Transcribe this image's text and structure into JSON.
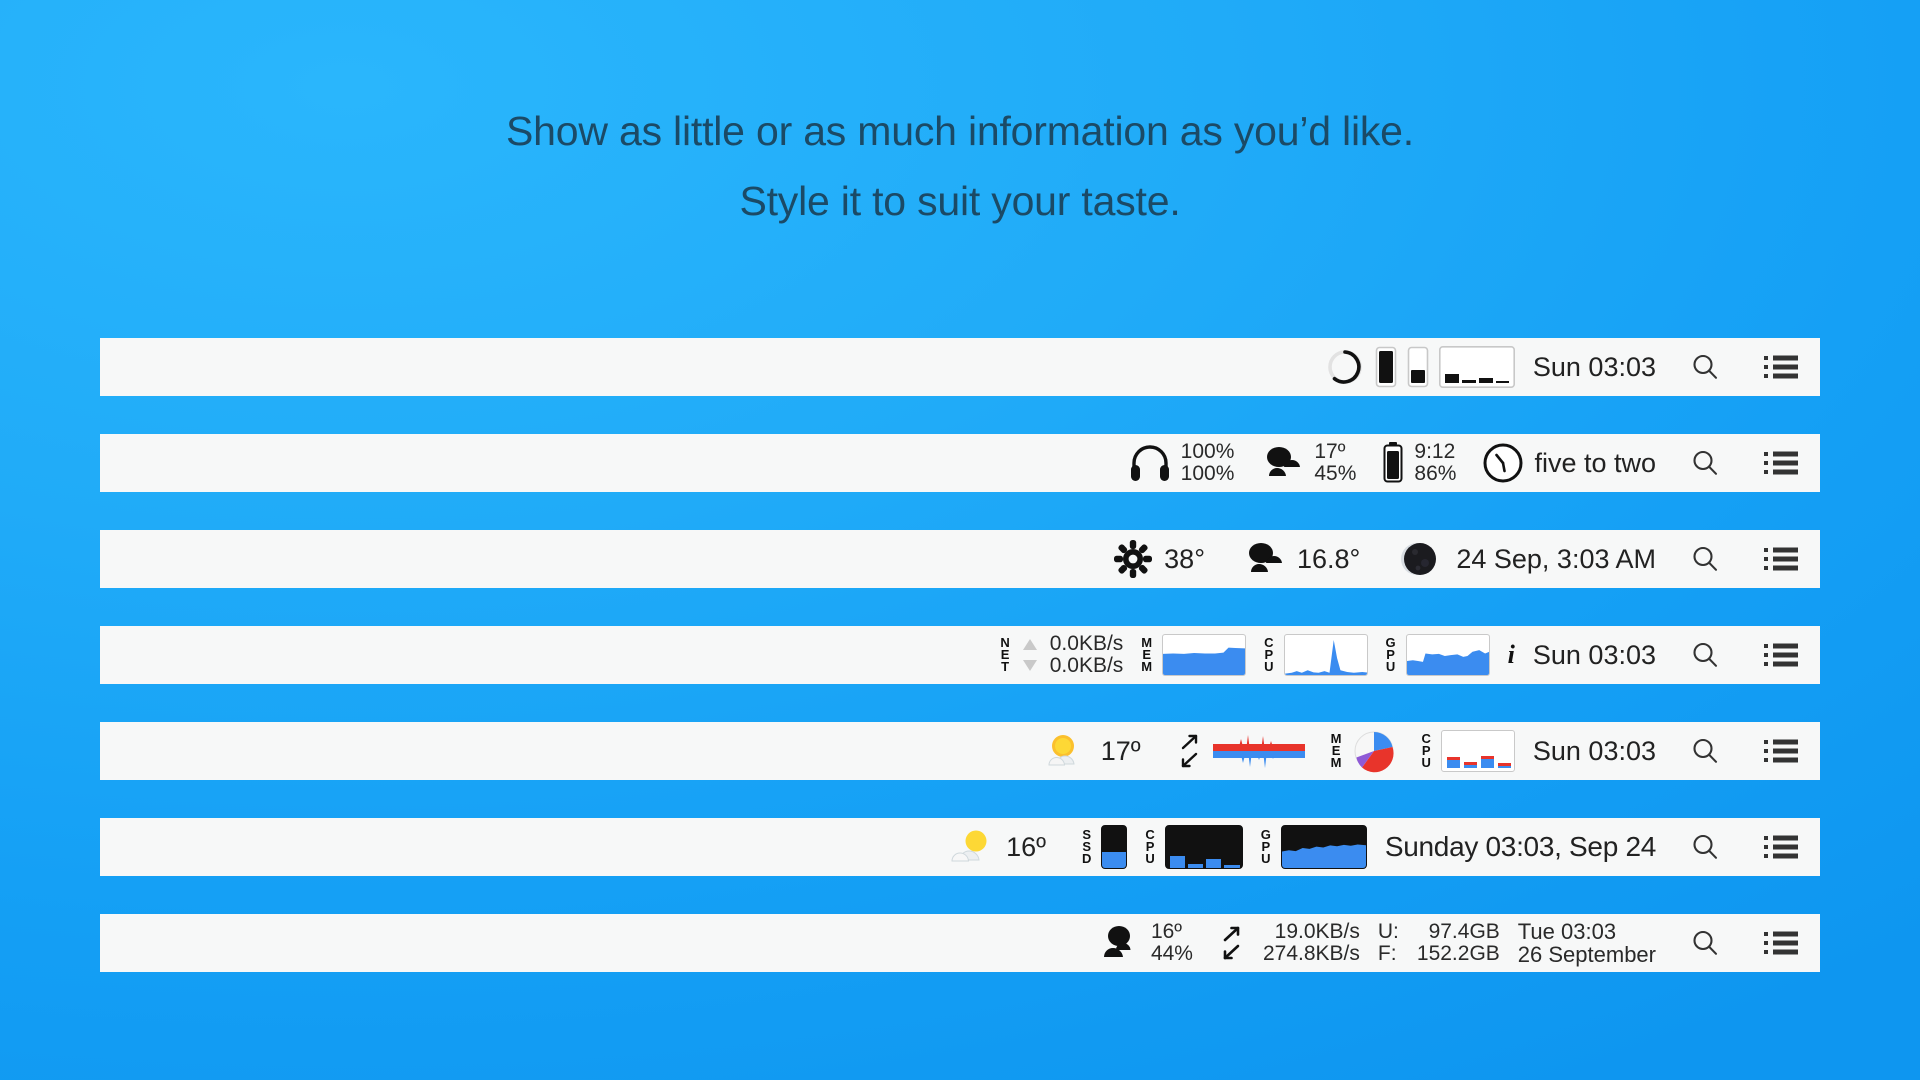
{
  "headline": {
    "line1": "Show as little or as much information as you’d like.",
    "line2": "Style it to suit your taste."
  },
  "colors": {
    "background_start": "#2ab6fc",
    "background_end": "#0e96f0",
    "bar_background": "#f7f8f8",
    "text": "#222222",
    "graph_blue": "#3b8cf0",
    "graph_red": "#e8342b",
    "graph_purple": "#8f5ad6"
  },
  "system_icons": {
    "search_label": "search-icon",
    "menu_label": "control-center-icon"
  },
  "bars": [
    {
      "id": "bar-1",
      "items": [
        {
          "type": "ring-gauge",
          "name": "battery-ring-icon"
        },
        {
          "type": "vertical-bar",
          "name": "battery-vertical-icon",
          "fill_percent": 92
        },
        {
          "type": "vertical-bar",
          "name": "storage-vertical-icon",
          "fill_percent": 38
        },
        {
          "type": "mini-bar-graph",
          "name": "cpu-bar-graph",
          "values": [
            30,
            12,
            16,
            8
          ]
        }
      ],
      "clock": "Sun 03:03"
    },
    {
      "id": "bar-2",
      "items": [
        {
          "type": "icon-stat",
          "name": "headphones-icon",
          "line1": "100%",
          "line2": "100%"
        },
        {
          "type": "icon-stat",
          "name": "cloudy-weather-icon",
          "line1": "17º",
          "line2": "45%"
        },
        {
          "type": "icon-stat",
          "name": "battery-icon",
          "line1": "9:12",
          "line2": "86%"
        },
        {
          "type": "analog-clock",
          "name": "analog-clock-icon"
        }
      ],
      "clock": "five to two"
    },
    {
      "id": "bar-3",
      "items": [
        {
          "type": "icon-value",
          "name": "fan-icon",
          "value": "38°"
        },
        {
          "type": "icon-value",
          "name": "cloudy-weather-icon",
          "value": "16.8°"
        },
        {
          "type": "moon-phase",
          "name": "moon-phase-icon"
        }
      ],
      "clock": "24 Sep, 3:03 AM"
    },
    {
      "id": "bar-4",
      "items": [
        {
          "type": "net-stat",
          "name": "network-stat",
          "label": "NET",
          "up": "0.0KB/s",
          "down": "0.0KB/s"
        },
        {
          "type": "labeled-graph",
          "name": "memory-graph",
          "label": "MEM",
          "style": "area-light",
          "values": [
            55,
            56,
            55,
            57,
            56,
            56,
            57,
            56,
            57,
            58,
            58,
            66,
            64,
            65,
            65,
            63
          ]
        },
        {
          "type": "labeled-graph",
          "name": "cpu-graph",
          "label": "CPU",
          "style": "spike-light",
          "values": [
            6,
            5,
            8,
            6,
            10,
            7,
            6,
            9,
            6,
            7,
            88,
            40,
            12,
            8,
            7,
            6
          ]
        },
        {
          "type": "labeled-graph",
          "name": "gpu-graph",
          "label": "GPU",
          "style": "area-light",
          "values": [
            42,
            40,
            41,
            38,
            52,
            54,
            53,
            50,
            49,
            52,
            50,
            48,
            47,
            58,
            62,
            55
          ]
        },
        {
          "type": "info-icon",
          "name": "info-icon",
          "glyph": "i"
        }
      ],
      "clock": "Sun 03:03"
    },
    {
      "id": "bar-5",
      "items": [
        {
          "type": "icon-value",
          "name": "partly-cloudy-color-icon",
          "value": "17º"
        },
        {
          "type": "net-arrows",
          "name": "network-arrows-icon"
        },
        {
          "type": "waveform",
          "name": "network-waveform-graph",
          "up_values": [
            4,
            5,
            6,
            30,
            64,
            22,
            10,
            48,
            14,
            36,
            10,
            6,
            5,
            4
          ],
          "down_values": [
            5,
            6,
            8,
            12,
            34,
            14,
            52,
            20,
            60,
            18,
            9,
            6,
            5,
            4
          ]
        },
        {
          "type": "labeled-pie",
          "name": "memory-pie-chart",
          "label": "MEM",
          "slices": [
            {
              "value": 46,
              "color": "#e8342b"
            },
            {
              "value": 22,
              "color": "#3b8cf0"
            },
            {
              "value": 6,
              "color": "#8f5ad6"
            },
            {
              "value": 26,
              "color": "#f2f2f2"
            }
          ]
        },
        {
          "type": "labeled-graph",
          "name": "cpu-bar-graph",
          "label": "CPU",
          "style": "bars-redblue",
          "values": [
            26,
            14,
            30,
            12
          ]
        }
      ],
      "clock": "Sun 03:03"
    },
    {
      "id": "bar-6",
      "items": [
        {
          "type": "icon-value",
          "name": "partly-sunny-color-icon",
          "value": "16º"
        },
        {
          "type": "labeled-graph",
          "name": "ssd-gauge",
          "label": "SSD",
          "style": "vertical-dark",
          "fill_percent": 40
        },
        {
          "type": "labeled-graph",
          "name": "cpu-graph",
          "label": "CPU",
          "style": "bars-dark",
          "values": [
            38,
            14,
            26,
            10
          ]
        },
        {
          "type": "labeled-graph",
          "name": "gpu-graph",
          "label": "GPU",
          "style": "area-dark",
          "values": [
            44,
            46,
            45,
            48,
            50,
            49,
            52,
            51,
            53,
            52,
            54,
            53,
            55,
            54,
            56,
            55
          ]
        }
      ],
      "clock": "Sunday 03:03, Sep 24"
    },
    {
      "id": "bar-7",
      "items": [
        {
          "type": "icon-stat",
          "name": "cloudy-weather-icon",
          "line1": "16º",
          "line2": "44%"
        },
        {
          "type": "net-arrows",
          "name": "network-arrows-icon"
        },
        {
          "type": "two-line-value",
          "name": "network-speed",
          "line1": "19.0KB/s",
          "line2": "274.8KB/s"
        },
        {
          "type": "labeled-pair",
          "name": "disk-usage",
          "key1": "U:",
          "val1": "97.4GB",
          "key2": "F:",
          "val2": "152.2GB"
        }
      ],
      "clock_line1": "Tue 03:03",
      "clock_line2": "26 September"
    }
  ]
}
